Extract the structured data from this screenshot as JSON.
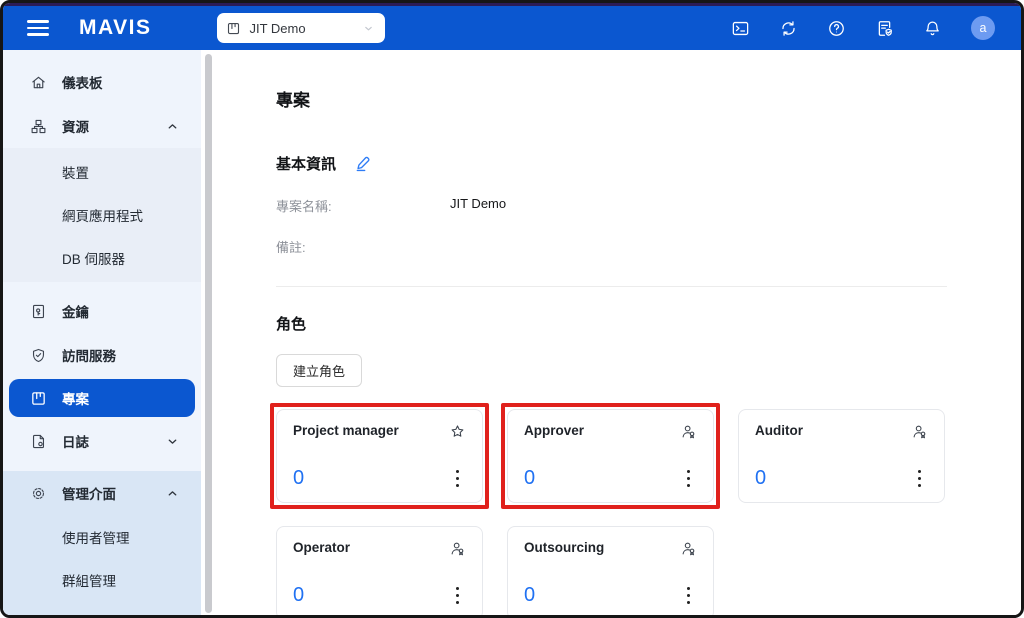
{
  "header": {
    "logo": "MAVIS",
    "menu_icon": "hamburger-icon",
    "project_selector": {
      "value": "JIT Demo",
      "icon": "project-icon",
      "chevron": "chevron-down-icon"
    },
    "icons": [
      "terminal-icon",
      "sync-icon",
      "help-icon",
      "policy-doc-icon",
      "bell-icon"
    ],
    "avatar_initial": "a"
  },
  "sidebar": {
    "items": [
      {
        "label": "儀表板",
        "icon": "home-icon"
      },
      {
        "label": "資源",
        "icon": "sitemap-icon",
        "state": "expanded"
      },
      {
        "label": "裝置"
      },
      {
        "label": "網頁應用程式"
      },
      {
        "label": "DB 伺服器"
      },
      {
        "label": "金鑰",
        "icon": "key-file-icon"
      },
      {
        "label": "訪問服務",
        "icon": "shield-check-icon"
      },
      {
        "label": "專案",
        "icon": "project-icon",
        "state": "active"
      },
      {
        "label": "日誌",
        "icon": "log-file-icon",
        "state": "collapsed"
      },
      {
        "label": "管理介面",
        "icon": "gear-icon",
        "state": "expanded"
      },
      {
        "label": "使用者管理"
      },
      {
        "label": "群組管理"
      }
    ]
  },
  "main": {
    "title": "專案",
    "basic_info": {
      "heading": "基本資訊",
      "edit_icon": "pencil-line-icon",
      "fields": [
        {
          "label": "專案名稱:",
          "value": "JIT Demo"
        },
        {
          "label": "備註:",
          "value": ""
        }
      ]
    },
    "roles": {
      "heading": "角色",
      "create_button_label": "建立角色",
      "cards": [
        {
          "name": "Project manager",
          "count": "0",
          "icon": "star-icon",
          "highlighted": true
        },
        {
          "name": "Approver",
          "count": "0",
          "icon": "user-award-icon",
          "highlighted": true
        },
        {
          "name": "Auditor",
          "count": "0",
          "icon": "user-award-icon",
          "highlighted": false
        },
        {
          "name": "Operator",
          "count": "0",
          "icon": "user-award-icon",
          "highlighted": false
        },
        {
          "name": "Outsourcing",
          "count": "0",
          "icon": "user-award-icon",
          "highlighted": false
        }
      ]
    }
  },
  "colors": {
    "header_bg": "#0b57d0",
    "accent_blue": "#0b57d0",
    "count_blue": "#2071f2",
    "annotation_red": "#e0211c",
    "sidebar_bg": "#eff4fc",
    "sidebar_group_bg": "#e9eef7",
    "sidebar_admin_group_bg": "#d9e6f5",
    "top_strip": "#2b1c57"
  }
}
